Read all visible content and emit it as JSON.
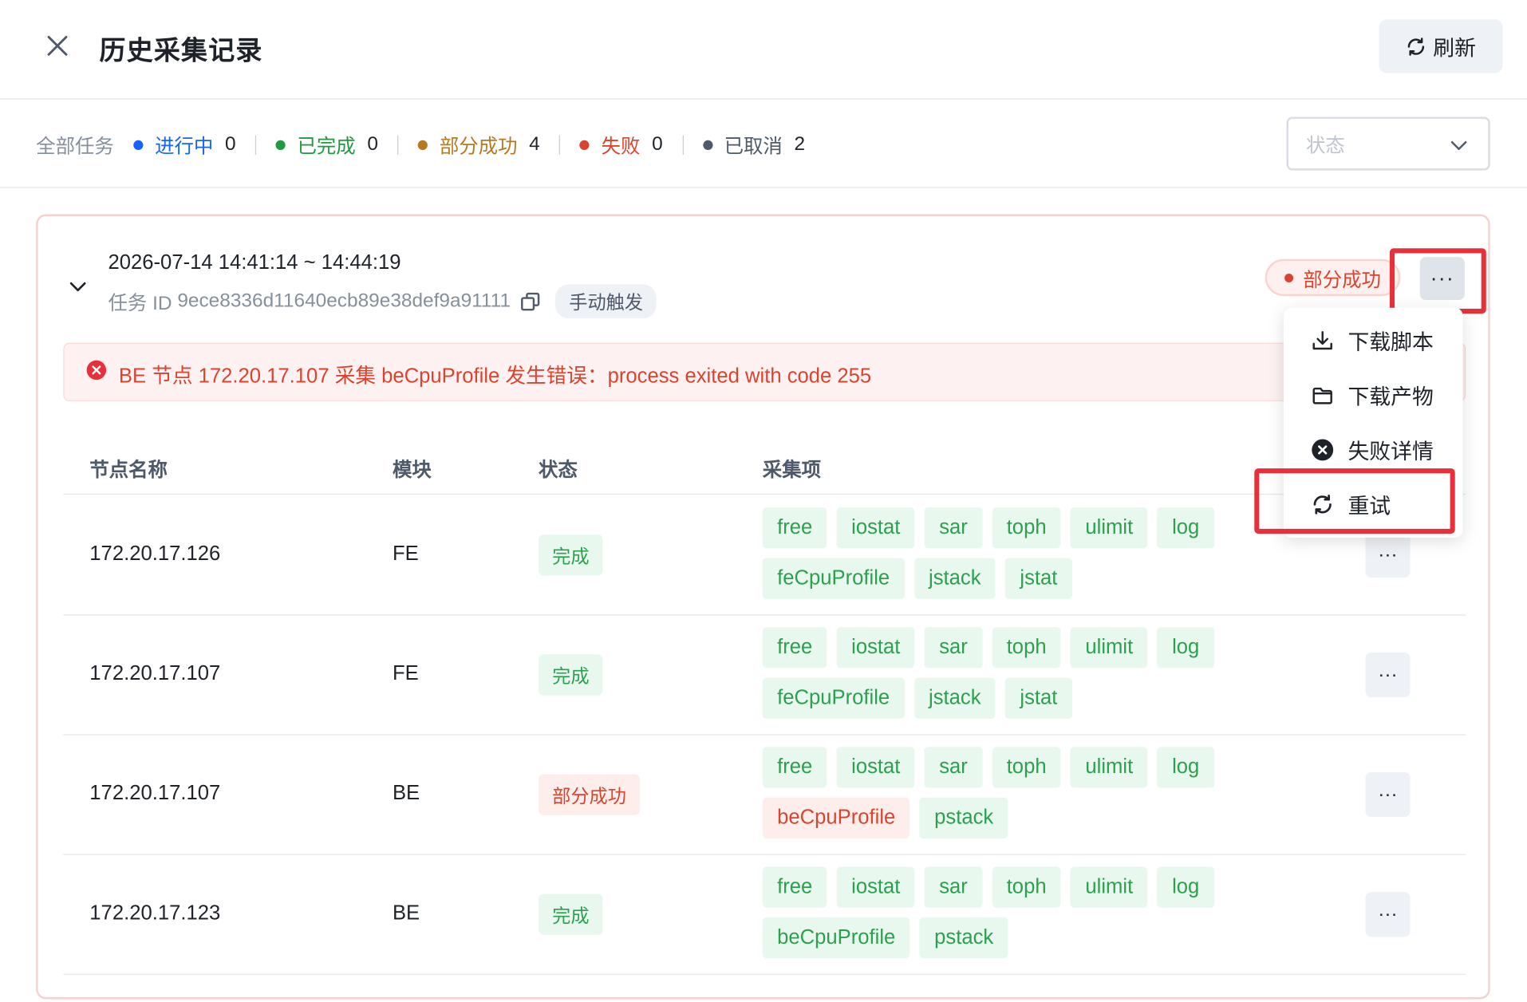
{
  "header": {
    "title": "历史采集记录",
    "refresh_label": "刷新"
  },
  "filters": {
    "all_label": "全部任务",
    "items": [
      {
        "label": "进行中",
        "count": "0",
        "color": "#1664ff"
      },
      {
        "label": "已完成",
        "count": "0",
        "color": "#1f9a3e"
      },
      {
        "label": "部分成功",
        "count": "4",
        "color": "#b7791f"
      },
      {
        "label": "失败",
        "count": "0",
        "color": "#d9442f"
      },
      {
        "label": "已取消",
        "count": "2",
        "color": "#4e5969"
      }
    ],
    "status_placeholder": "状态"
  },
  "task": {
    "time_range": "2026-07-14 14:41:14 ~ 14:44:19",
    "task_id_label": "任务 ID",
    "task_id": "9ece8336d11640ecb89e38def9a91111",
    "trigger": "手动触发",
    "status": "部分成功",
    "more_label": "···",
    "error": "BE 节点 172.20.17.107 采集 beCpuProfile 发生错误：process exited with code 255"
  },
  "table": {
    "headers": [
      "节点名称",
      "模块",
      "状态",
      "采集项"
    ],
    "rows": [
      {
        "node": "172.20.17.126",
        "module": "FE",
        "status": "完成",
        "status_type": "ok",
        "items": [
          {
            "name": "free",
            "ok": true
          },
          {
            "name": "iostat",
            "ok": true
          },
          {
            "name": "sar",
            "ok": true
          },
          {
            "name": "toph",
            "ok": true
          },
          {
            "name": "ulimit",
            "ok": true
          },
          {
            "name": "log",
            "ok": true
          },
          {
            "name": "feCpuProfile",
            "ok": true
          },
          {
            "name": "jstack",
            "ok": true
          },
          {
            "name": "jstat",
            "ok": true
          }
        ]
      },
      {
        "node": "172.20.17.107",
        "module": "FE",
        "status": "完成",
        "status_type": "ok",
        "items": [
          {
            "name": "free",
            "ok": true
          },
          {
            "name": "iostat",
            "ok": true
          },
          {
            "name": "sar",
            "ok": true
          },
          {
            "name": "toph",
            "ok": true
          },
          {
            "name": "ulimit",
            "ok": true
          },
          {
            "name": "log",
            "ok": true
          },
          {
            "name": "feCpuProfile",
            "ok": true
          },
          {
            "name": "jstack",
            "ok": true
          },
          {
            "name": "jstat",
            "ok": true
          }
        ]
      },
      {
        "node": "172.20.17.107",
        "module": "BE",
        "status": "部分成功",
        "status_type": "part",
        "items": [
          {
            "name": "free",
            "ok": true
          },
          {
            "name": "iostat",
            "ok": true
          },
          {
            "name": "sar",
            "ok": true
          },
          {
            "name": "toph",
            "ok": true
          },
          {
            "name": "ulimit",
            "ok": true
          },
          {
            "name": "log",
            "ok": true
          },
          {
            "name": "beCpuProfile",
            "ok": false
          },
          {
            "name": "pstack",
            "ok": true
          }
        ]
      },
      {
        "node": "172.20.17.123",
        "module": "BE",
        "status": "完成",
        "status_type": "ok",
        "items": [
          {
            "name": "free",
            "ok": true
          },
          {
            "name": "iostat",
            "ok": true
          },
          {
            "name": "sar",
            "ok": true
          },
          {
            "name": "toph",
            "ok": true
          },
          {
            "name": "ulimit",
            "ok": true
          },
          {
            "name": "log",
            "ok": true
          },
          {
            "name": "beCpuProfile",
            "ok": true
          },
          {
            "name": "pstack",
            "ok": true
          }
        ]
      }
    ],
    "row_more_label": "···"
  },
  "menu": {
    "items": [
      {
        "label": "下载脚本",
        "icon": "download-icon"
      },
      {
        "label": "下载产物",
        "icon": "folder-icon"
      },
      {
        "label": "失败详情",
        "icon": "error-circle-icon"
      },
      {
        "label": "重试",
        "icon": "retry-icon"
      }
    ]
  },
  "colors": {
    "success": "#2ba04d",
    "error": "#d9442f",
    "highlight": "#e8303a"
  }
}
